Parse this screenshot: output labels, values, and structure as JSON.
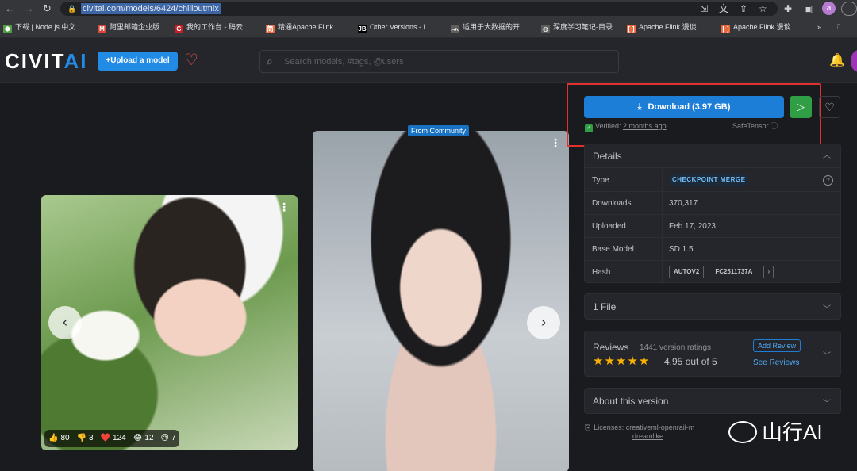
{
  "browser": {
    "url": "civitai.com/models/6424/chilloutmix",
    "avatar_letter": "a",
    "bookmarks": [
      {
        "label": "下载 | Node.js 中文...",
        "icon": "nodejs-icon",
        "color": "#539e43",
        "glyph": "⬢"
      },
      {
        "label": "阿里邮箱企业版",
        "icon": "aliyun-mail-icon",
        "color": "#d44638",
        "glyph": "M"
      },
      {
        "label": "我的工作台 - 码云...",
        "icon": "gitee-icon",
        "color": "#c71d23",
        "glyph": "G"
      },
      {
        "label": "精通Apache Flink...",
        "icon": "book-icon",
        "color": "#e8663d",
        "glyph": "简"
      },
      {
        "label": "Other Versions - I...",
        "icon": "jetbrains-icon",
        "color": "#000000",
        "glyph": "JB"
      },
      {
        "label": "适用于大数据的开...",
        "icon": "flink-icon",
        "color": "#5e5e5e",
        "glyph": "ᨒ"
      },
      {
        "label": "深度学习笔记-目录",
        "icon": "globe-icon",
        "color": "#5e5e5e",
        "glyph": "◍"
      },
      {
        "label": "Apache Flink 漫谈...",
        "icon": "bracket-icon",
        "color": "#e8663d",
        "glyph": "[·]"
      },
      {
        "label": "Apache Flink 漫谈...",
        "icon": "bracket-icon",
        "color": "#e8663d",
        "glyph": "[·]"
      }
    ],
    "more_bookmarks": "»"
  },
  "header": {
    "logo_main": "CIVIT",
    "logo_accent": "AI",
    "upload_label": "Upload a model",
    "search_placeholder": "Search models, #tags, @users"
  },
  "gallery": {
    "community_badge": "From Community",
    "reactions": [
      {
        "icon": "👍",
        "count": "80"
      },
      {
        "icon": "👎",
        "count": "3"
      },
      {
        "icon": "❤️",
        "count": "124"
      },
      {
        "icon": "😂",
        "count": "12"
      },
      {
        "icon": "😢",
        "count": "7"
      }
    ]
  },
  "download": {
    "label": "Download (3.97 GB)",
    "verified_prefix": "Verified:",
    "verified_when": "2 months ago",
    "format": "SafeTensor"
  },
  "details": {
    "title": "Details",
    "rows": [
      {
        "key": "Type",
        "value": "CHECKPOINT MERGE"
      },
      {
        "key": "Downloads",
        "value": "370,317"
      },
      {
        "key": "Uploaded",
        "value": "Feb 17, 2023"
      },
      {
        "key": "Base Model",
        "value": "SD 1.5"
      },
      {
        "key": "Hash",
        "value": ""
      }
    ],
    "hash_algorithm": "AUTOV2",
    "hash_value": "FC2511737A"
  },
  "files": {
    "title": "1 File"
  },
  "reviews": {
    "title": "Reviews",
    "count_text": "1441 version ratings",
    "rating": 4.95,
    "rating_text": "4.95 out of 5",
    "stars": "★★★★★",
    "add_label": "Add Review",
    "see_label": "See Reviews"
  },
  "about": {
    "title": "About this version"
  },
  "license": {
    "prefix": "Licenses:",
    "items": [
      "creativeml-openrail-m",
      "dreamlike"
    ]
  },
  "watermark": {
    "text": "山行AI"
  },
  "colors": {
    "accent": "#228be6",
    "download": "#1c7ed6",
    "play": "#2f9e44",
    "highlight": "#e03131",
    "stars": "#fab005"
  }
}
